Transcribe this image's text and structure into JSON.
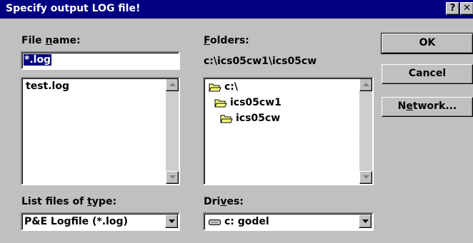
{
  "dialog": {
    "title": "Specify output LOG file!",
    "help_glyph": "?",
    "close_glyph": "✕"
  },
  "file_name": {
    "label_pre": "File ",
    "label_u": "n",
    "label_post": "ame:",
    "value": "*.log",
    "files": [
      "test.log"
    ]
  },
  "folders": {
    "label_u": "F",
    "label_post": "olders:",
    "current_path": "c:\\ics05cw1\\ics05cw",
    "tree": [
      "c:\\",
      "ics05cw1",
      "ics05cw"
    ]
  },
  "file_type": {
    "label_pre": "List files of ",
    "label_u": "t",
    "label_post": "ype:",
    "selected": "P&E Logfile (*.log)"
  },
  "drives": {
    "label_pre": "Dri",
    "label_u": "v",
    "label_post": "es:",
    "selected": "c: godel"
  },
  "buttons": {
    "ok": "OK",
    "cancel": "Cancel",
    "network_pre": "N",
    "network_u": "e",
    "network_post": "twork..."
  },
  "icons": {
    "folder": "folder-icon",
    "drive": "drive-icon",
    "up_arrow": "scroll-up-arrow-icon",
    "down_arrow": "scroll-down-arrow-icon"
  },
  "colors": {
    "titlebar": "#000080",
    "face": "#c0c0c0",
    "selection": "#000080",
    "folder": "#ffff80"
  }
}
